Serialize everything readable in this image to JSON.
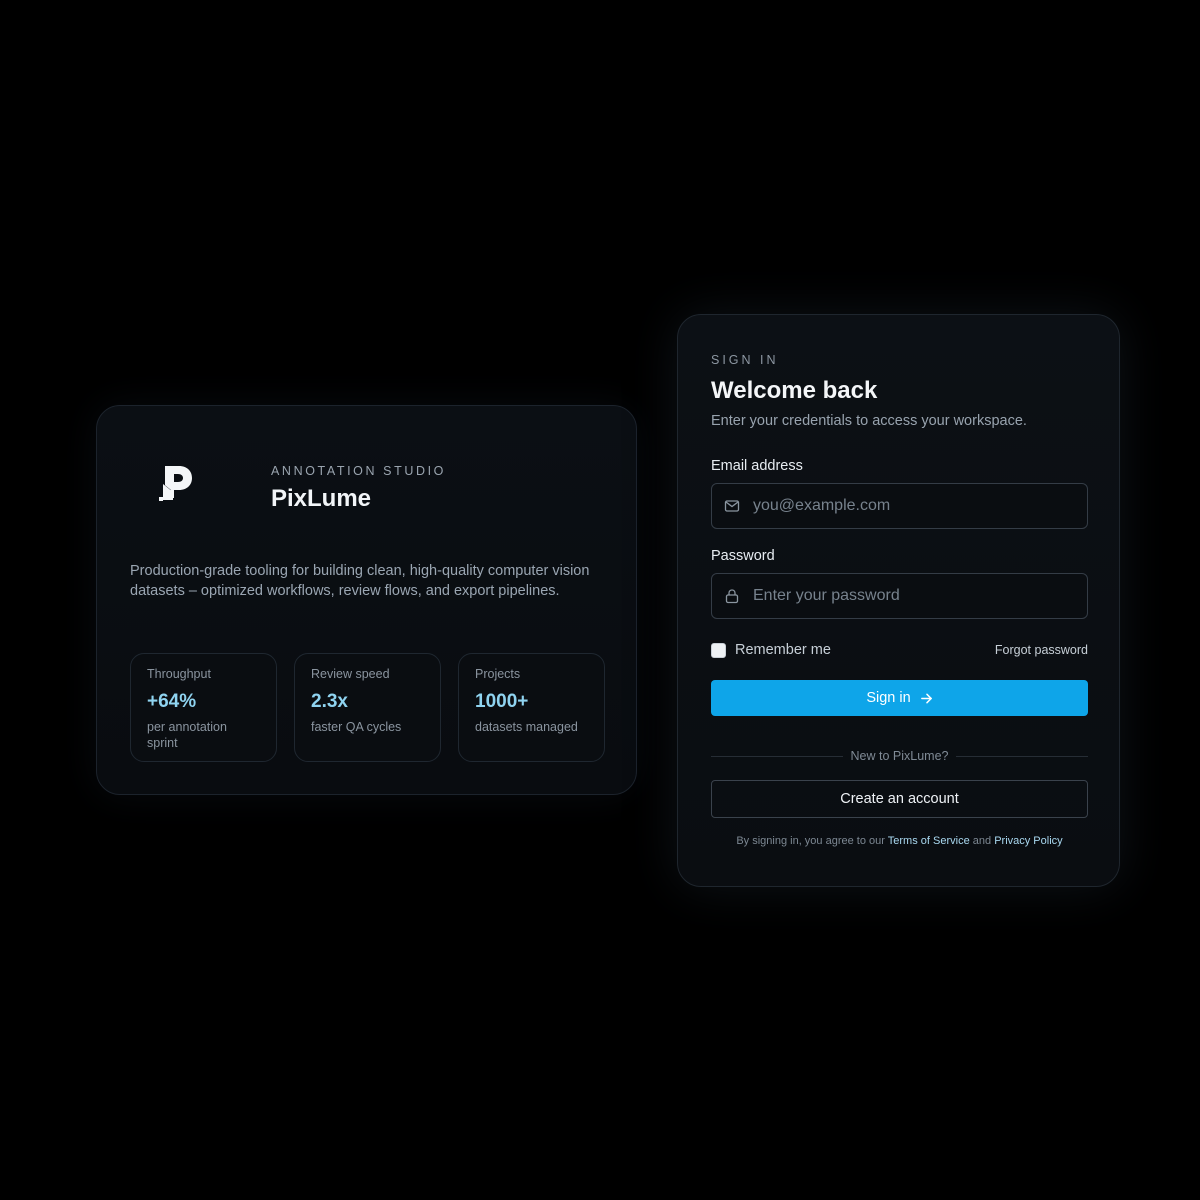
{
  "brand": {
    "eyebrow": "ANNOTATION STUDIO",
    "name": "PixLume",
    "logo_icon": "pixlume-logo-icon",
    "description": "Production-grade tooling for building clean, high-quality computer vision datasets – optimized workflows, review flows, and export pipelines.",
    "stats": [
      {
        "label": "Throughput",
        "value": "+64%",
        "sub": "per annotation sprint"
      },
      {
        "label": "Review speed",
        "value": "2.3x",
        "sub": "faster QA cycles"
      },
      {
        "label": "Projects",
        "value": "1000+",
        "sub": "datasets managed"
      }
    ]
  },
  "signin": {
    "eyebrow": "SIGN IN",
    "title": "Welcome back",
    "subtitle": "Enter your credentials to access your workspace.",
    "email": {
      "label": "Email address",
      "placeholder": "you@example.com",
      "value": "",
      "icon": "mail-icon"
    },
    "password": {
      "label": "Password",
      "placeholder": "Enter your password",
      "value": "",
      "icon": "lock-icon"
    },
    "remember_label": "Remember me",
    "remember_checked": false,
    "forgot_label": "Forgot password",
    "submit_label": "Sign in",
    "divider_text": "New to PixLume?",
    "create_label": "Create an account",
    "terms": {
      "prefix": "By signing in, you agree to our",
      "tos": "Terms of Service",
      "and": "and",
      "privacy": "Privacy Policy"
    }
  },
  "colors": {
    "accent": "#0ea5e9",
    "stat_value": "#8fd3f0",
    "background": "#000000"
  }
}
